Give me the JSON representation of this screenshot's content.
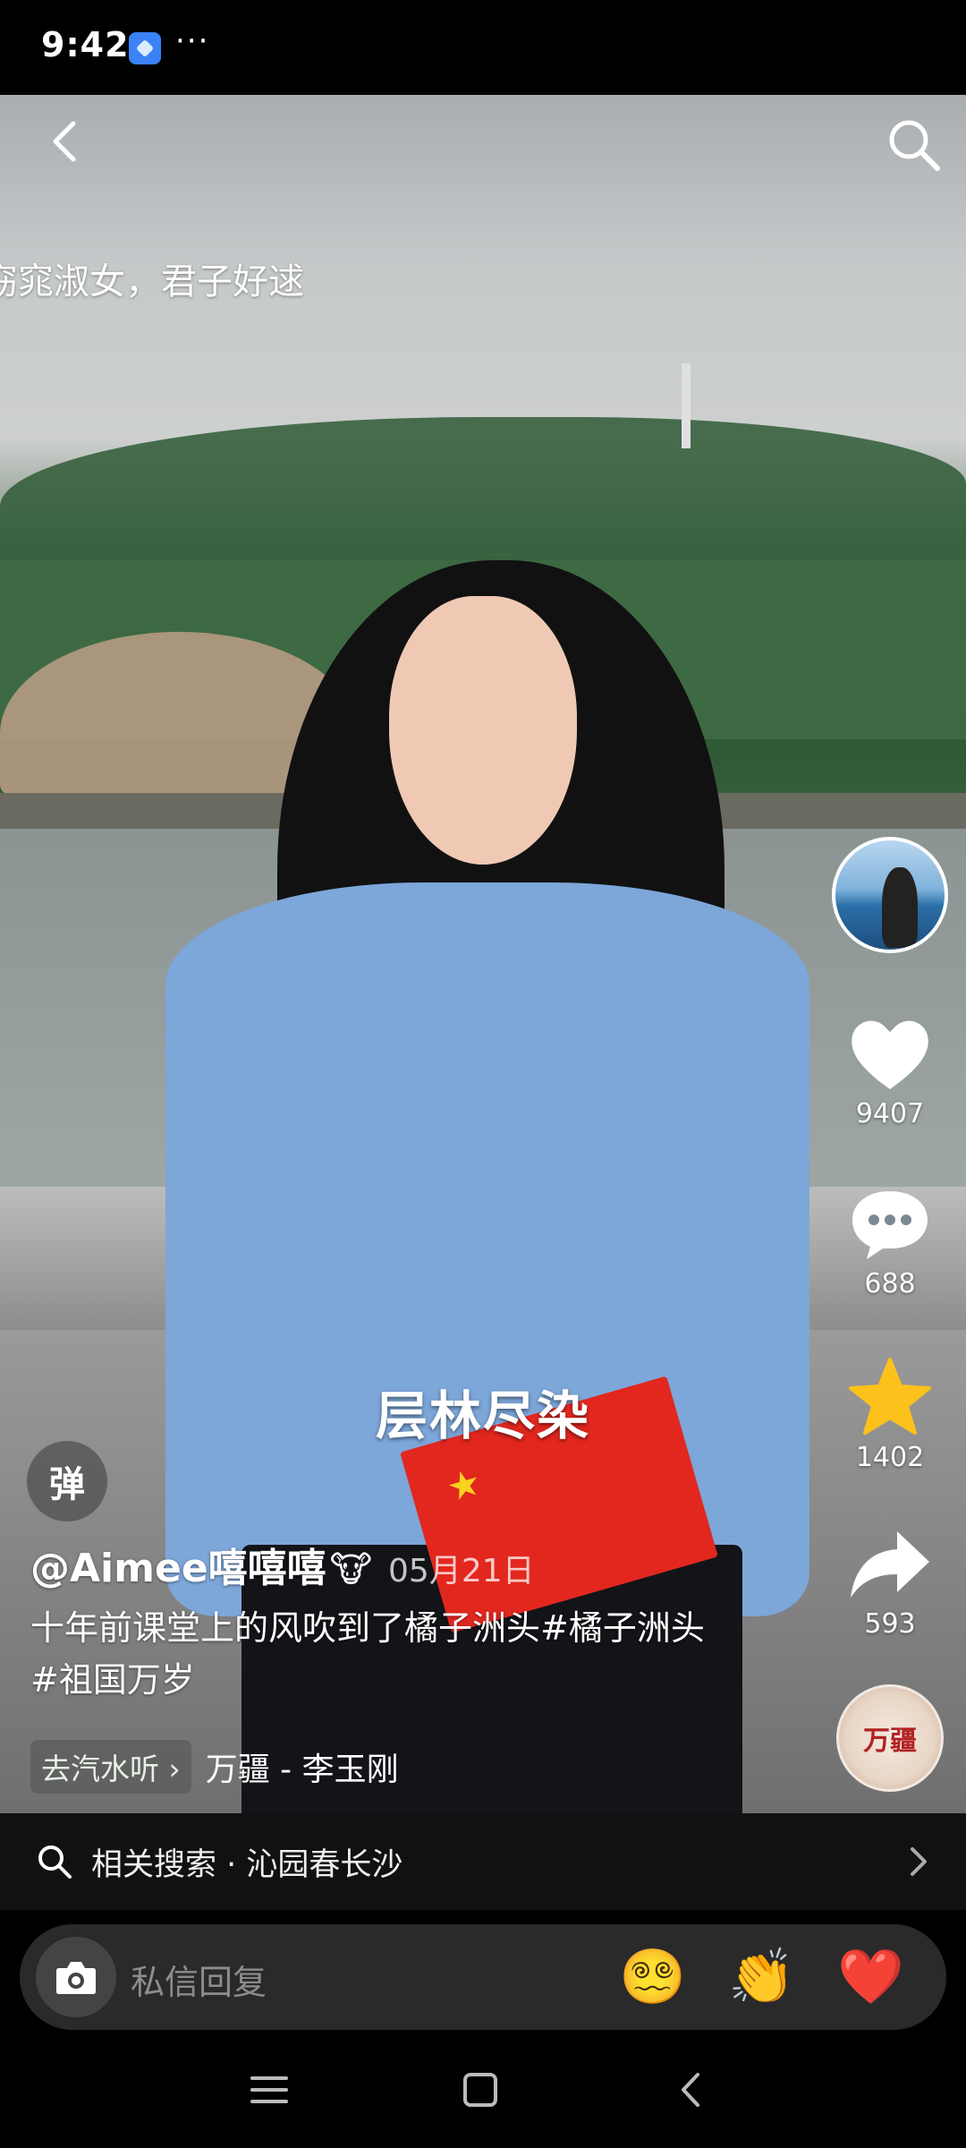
{
  "status_bar": {
    "time": "9:42",
    "more": "···"
  },
  "top": {
    "danmu": "窈窕淑女，君子好逑"
  },
  "right_rail": {
    "likes": "9407",
    "comments": "688",
    "favorites": "1402",
    "shares": "593",
    "music_disc_text": "万疆"
  },
  "video": {
    "caption": "层林尽染",
    "flag_stars": "★"
  },
  "info": {
    "danmu_toggle": "弹",
    "author": "@Aimee嘻嘻嘻",
    "author_emoji": "🐮",
    "date": "05月21日",
    "description": "十年前课堂上的风吹到了橘子洲头#橘子洲头#祖国万岁",
    "music_tag": "去汽水听 ›",
    "music_title": "万疆 - 李玉刚"
  },
  "related": {
    "label": "相关搜索 · 沁园春长沙"
  },
  "reply": {
    "placeholder": "私信回复",
    "emojis": [
      "😵‍💫",
      "👏",
      "❤️"
    ]
  },
  "colors": {
    "like": "#ffffff",
    "favorite": "#fcc21b",
    "flag": "#e2271f"
  }
}
